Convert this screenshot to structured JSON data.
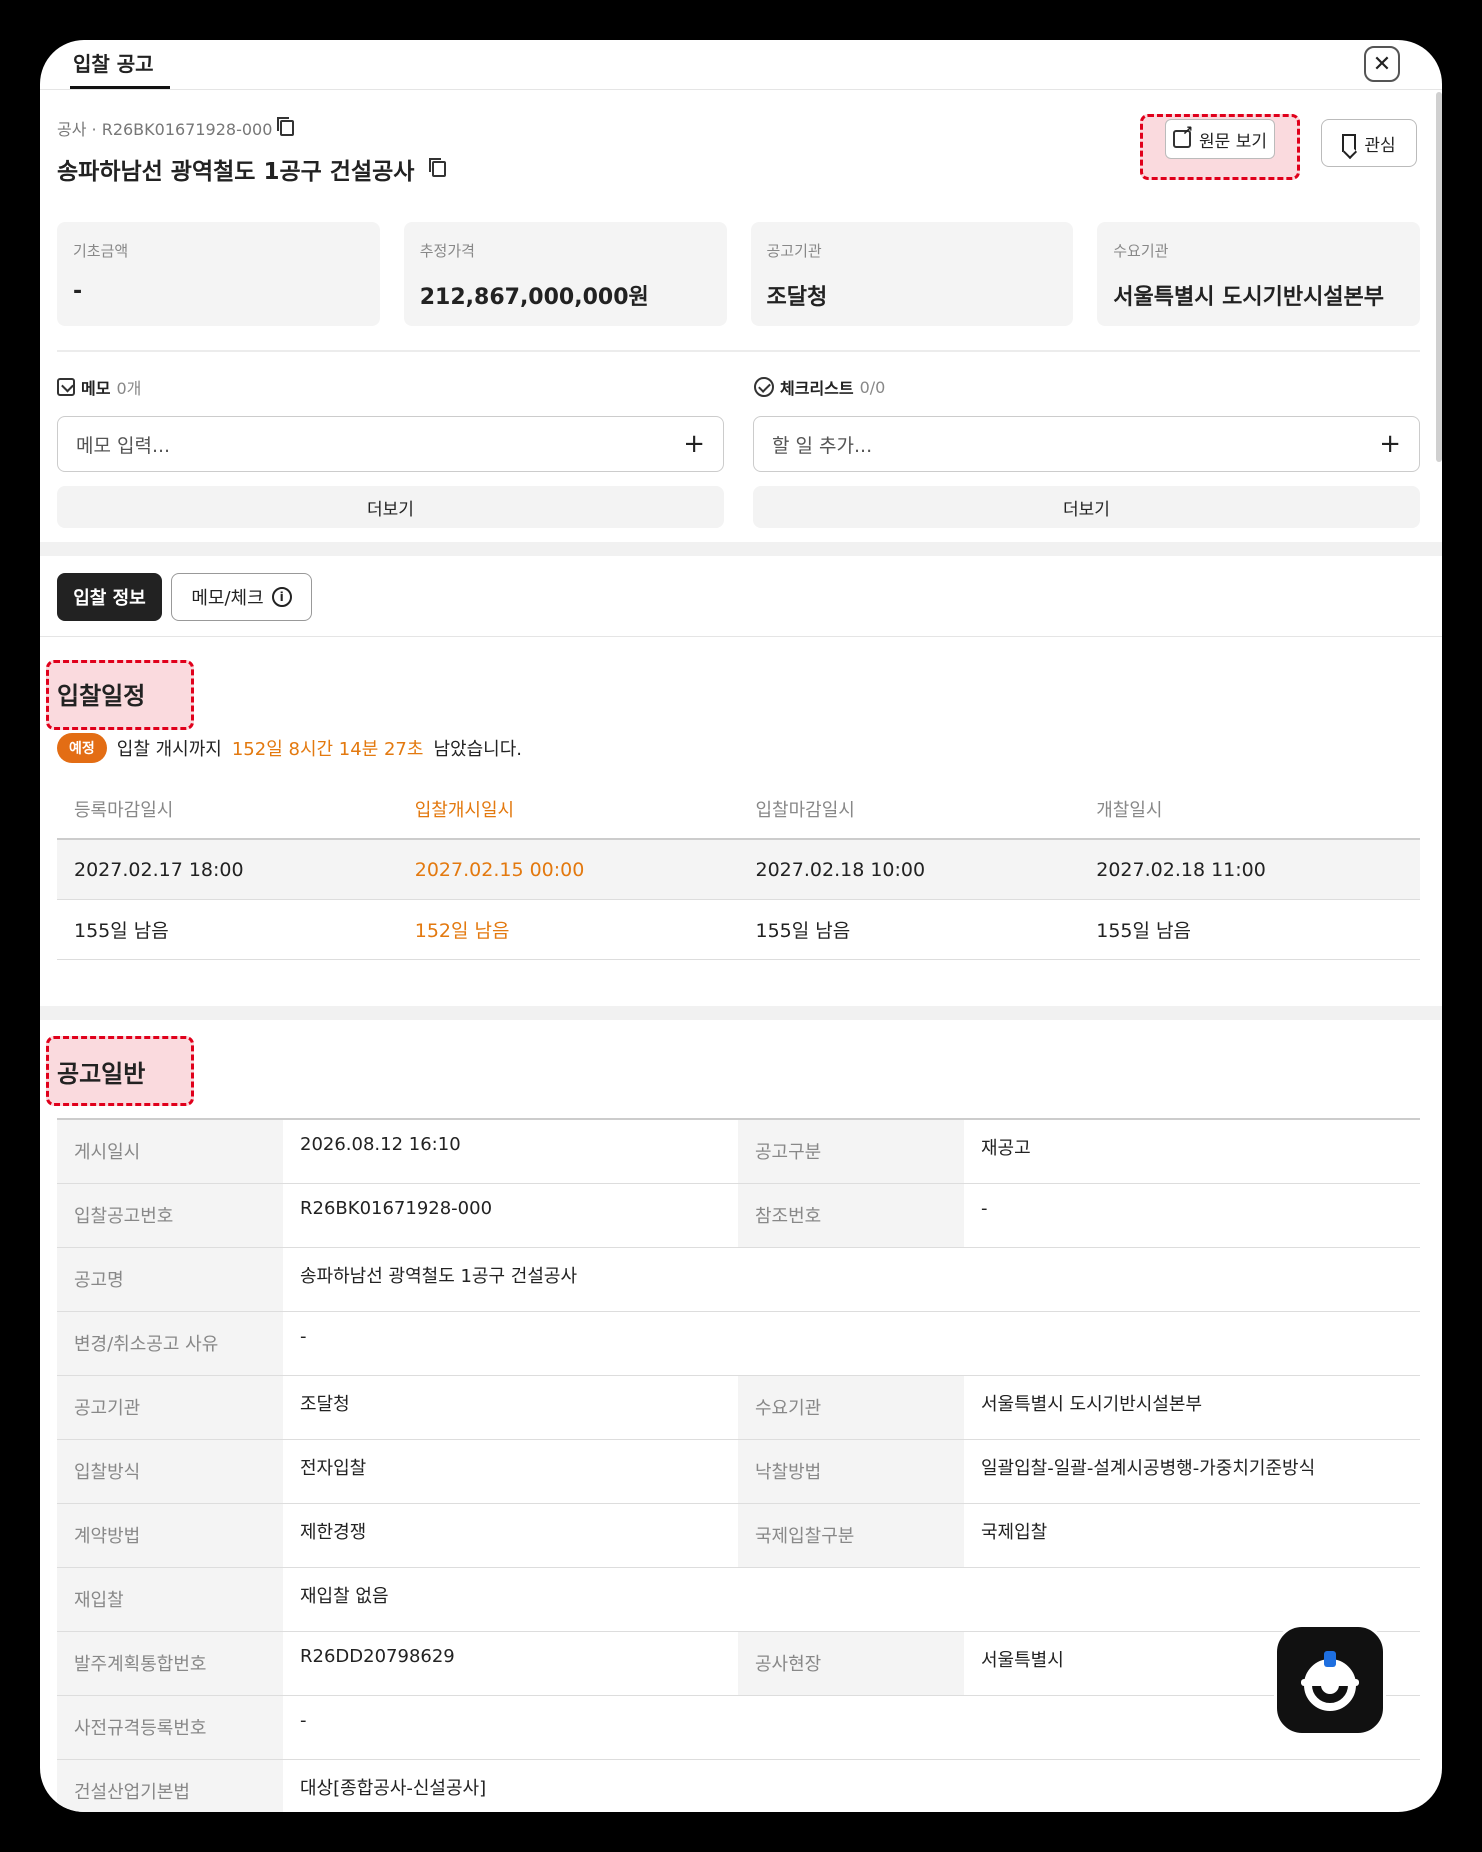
{
  "tab": {
    "label": "입찰 공고"
  },
  "close_icon": "close-icon",
  "header": {
    "meta": "공사 · R26BK01671928-000",
    "title": "송파하남선 광역철도 1공구 건설공사",
    "view_original_label": "원문 보기",
    "favorite_label": "관심"
  },
  "cards": [
    {
      "label": "기초금액",
      "value": "-"
    },
    {
      "label": "추정가격",
      "value": "212,867,000,000원"
    },
    {
      "label": "공고기관",
      "value": "조달청"
    },
    {
      "label": "수요기관",
      "value": "서울특별시 도시기반시설본부"
    }
  ],
  "memo": {
    "title": "메모",
    "count": "0개",
    "placeholder": "메모 입력...",
    "more": "더보기"
  },
  "checklist": {
    "title": "체크리스트",
    "count": "0/0",
    "placeholder": "할 일 추가...",
    "more": "더보기"
  },
  "segments": {
    "active": "입찰 정보",
    "idle": "메모/체크"
  },
  "schedule": {
    "section_title": "입찰일정",
    "badge": "예정",
    "status_prefix": "입찰 개시까지",
    "status_countdown": "152일 8시간 14분 27초",
    "status_suffix": "남았습니다.",
    "headers": [
      "등록마감일시",
      "입찰개시일시",
      "입찰마감일시",
      "개찰일시"
    ],
    "dates": [
      "2027.02.17 18:00",
      "2027.02.15 00:00",
      "2027.02.18 10:00",
      "2027.02.18 11:00"
    ],
    "remaining": [
      "155일 남음",
      "152일 남음",
      "155일 남음",
      "155일 남음"
    ]
  },
  "general": {
    "section_title": "공고일반",
    "rows": [
      {
        "k1": "게시일시",
        "v1": "2026.08.12 16:10",
        "k2": "공고구분",
        "v2": "재공고"
      },
      {
        "k1": "입찰공고번호",
        "v1": "R26BK01671928-000",
        "k2": "참조번호",
        "v2": "-"
      },
      {
        "k1": "공고명",
        "v1": "송파하남선 광역철도 1공구 건설공사"
      },
      {
        "k1": "변경/취소공고 사유",
        "v1": "-"
      },
      {
        "k1": "공고기관",
        "v1": "조달청",
        "k2": "수요기관",
        "v2": "서울특별시 도시기반시설본부"
      },
      {
        "k1": "입찰방식",
        "v1": "전자입찰",
        "k2": "낙찰방법",
        "v2": "일괄입찰-일괄-설계시공병행-가중치기준방식"
      },
      {
        "k1": "계약방법",
        "v1": "제한경쟁",
        "k2": "국제입찰구분",
        "v2": "국제입찰"
      },
      {
        "k1": "재입찰",
        "v1": "재입찰 없음"
      },
      {
        "k1": "발주계획통합번호",
        "v1": "R26DD20798629",
        "k2": "공사현장",
        "v2": "서울특별시"
      },
      {
        "k1": "사전규격등록번호",
        "v1": "-"
      },
      {
        "k1": "건설산업기본법",
        "v1": "대상[종합공사-신설공사]"
      }
    ]
  },
  "colors": {
    "accent_orange": "#e3790f",
    "highlight_red": "#e0001b",
    "dark": "#222222"
  }
}
